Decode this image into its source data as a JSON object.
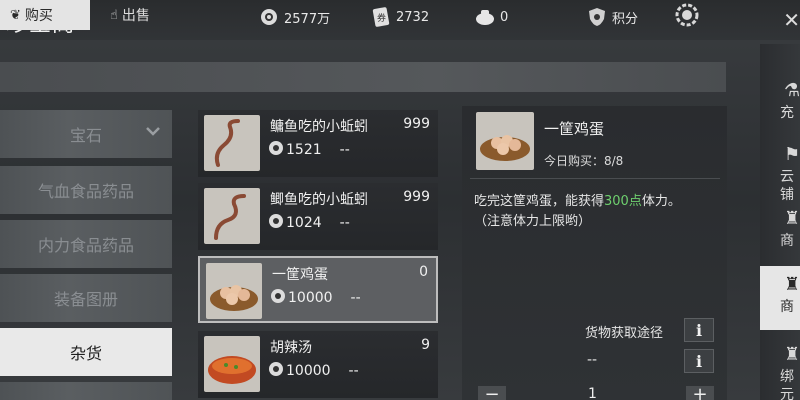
{
  "window": {
    "title": "珍宝阁"
  },
  "resources": {
    "money": "2577万",
    "tickets": "2732",
    "favor": "0",
    "points_label": "积分"
  },
  "tabs": {
    "buy": "购买",
    "sell": "出售"
  },
  "categories": [
    "宝石",
    "气血食品药品",
    "内力食品药品",
    "装备图册",
    "杂货"
  ],
  "items": [
    {
      "name": "鳙鱼吃的小蚯蚓",
      "stock": "999",
      "price": "1521",
      "price_alt": "--"
    },
    {
      "name": "鲫鱼吃的小蚯蚓",
      "stock": "999",
      "price": "1024",
      "price_alt": "--"
    },
    {
      "name": "一筐鸡蛋",
      "stock": "0",
      "price": "10000",
      "price_alt": "--"
    },
    {
      "name": "胡辣汤",
      "stock": "9",
      "price": "10000",
      "price_alt": "--"
    }
  ],
  "detail": {
    "name": "一筐鸡蛋",
    "limit_text": "今日购买：8/8",
    "desc_pre": "吃完这筐鸡蛋，能获得",
    "desc_highlight": "300点",
    "desc_post": "体力。",
    "desc_note": "（注意体力上限哟）",
    "source_label": "货物获取途径",
    "source_value": "--",
    "info_glyph": "i",
    "qty": "1",
    "minus": "−",
    "plus": "+"
  },
  "right_nav": [
    {
      "label": "充"
    },
    {
      "label": "云铺"
    },
    {
      "label": "商"
    },
    {
      "label": "商"
    },
    {
      "label": "绑元"
    }
  ],
  "colors": {
    "highlight": "#6ecf6e",
    "active_bg": "#e9e9e9"
  }
}
